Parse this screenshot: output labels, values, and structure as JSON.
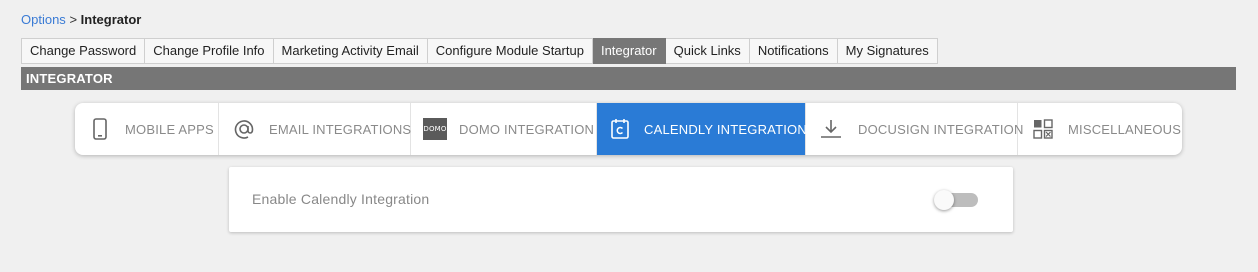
{
  "breadcrumb": {
    "parent": "Options",
    "separator": ">",
    "current": "Integrator"
  },
  "tabs": [
    {
      "label": "Change Password",
      "active": false
    },
    {
      "label": "Change Profile Info",
      "active": false
    },
    {
      "label": "Marketing Activity Email",
      "active": false
    },
    {
      "label": "Configure Module Startup",
      "active": false
    },
    {
      "label": "Integrator",
      "active": true
    },
    {
      "label": "Quick Links",
      "active": false
    },
    {
      "label": "Notifications",
      "active": false
    },
    {
      "label": "My Signatures",
      "active": false
    }
  ],
  "section": {
    "title": "INTEGRATOR"
  },
  "integration_tabs": [
    {
      "label": "MOBILE APPS",
      "icon": "mobile-phone-icon",
      "active": false
    },
    {
      "label": "EMAIL INTEGRATIONS",
      "icon": "at-sign-icon",
      "active": false
    },
    {
      "label": "DOMO INTEGRATION",
      "icon": "domo-logo-icon",
      "icon_text": "DOMO",
      "active": false
    },
    {
      "label": "CALENDLY INTEGRATION",
      "icon": "calendar-icon",
      "active": true
    },
    {
      "label": "DOCUSIGN INTEGRATION",
      "icon": "download-icon",
      "active": false
    },
    {
      "label": "MISCELLANEOUS",
      "icon": "grid-apps-icon",
      "active": false
    }
  ],
  "setting": {
    "label": "Enable Calendly Integration",
    "enabled": false
  },
  "colors": {
    "accent": "#2a7bd6",
    "section_bar": "#767676",
    "link": "#3a7bd5"
  }
}
